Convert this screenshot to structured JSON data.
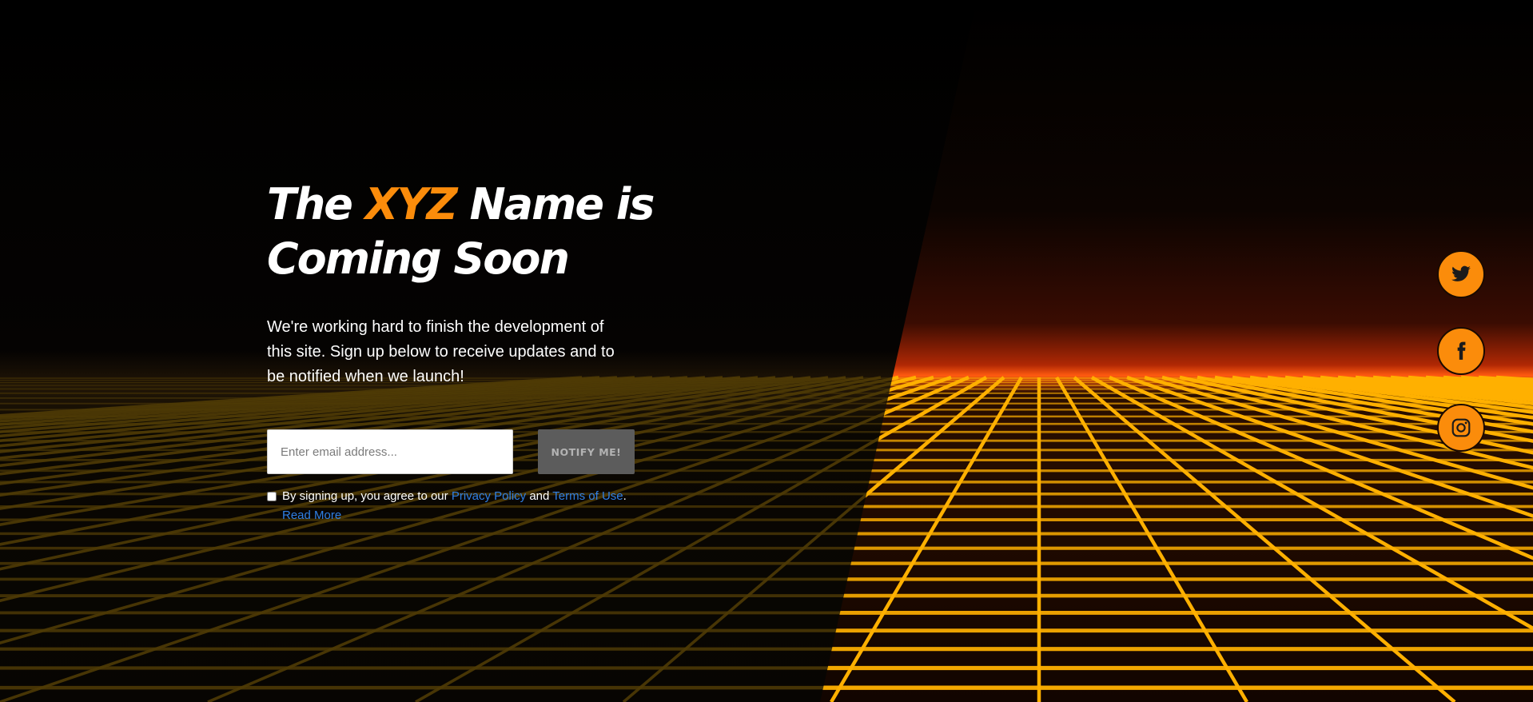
{
  "colors": {
    "accent": "#fb8c0b",
    "link": "#2f7fe5",
    "button_bg": "#5c5c5c"
  },
  "hero": {
    "title_prefix": "The",
    "title_brand": "XYZ",
    "title_suffix": "Name is",
    "title_line2": "Coming Soon",
    "intro": "We're working hard to finish the development of this site. Sign up below to receive updates and to be notified when we launch!"
  },
  "signup": {
    "email_placeholder": "Enter email address...",
    "email_value": "",
    "notify_label": "NOTIFY ME!",
    "terms_prefix": "By signing up, you agree to our",
    "privacy_label": "Privacy Policy",
    "and_label": "and",
    "terms_label": "Terms of Use",
    "terms_end": ".",
    "read_more": "Read More"
  },
  "social": [
    {
      "icon": "twitter-icon"
    },
    {
      "icon": "facebook-icon"
    },
    {
      "icon": "instagram-icon"
    }
  ]
}
